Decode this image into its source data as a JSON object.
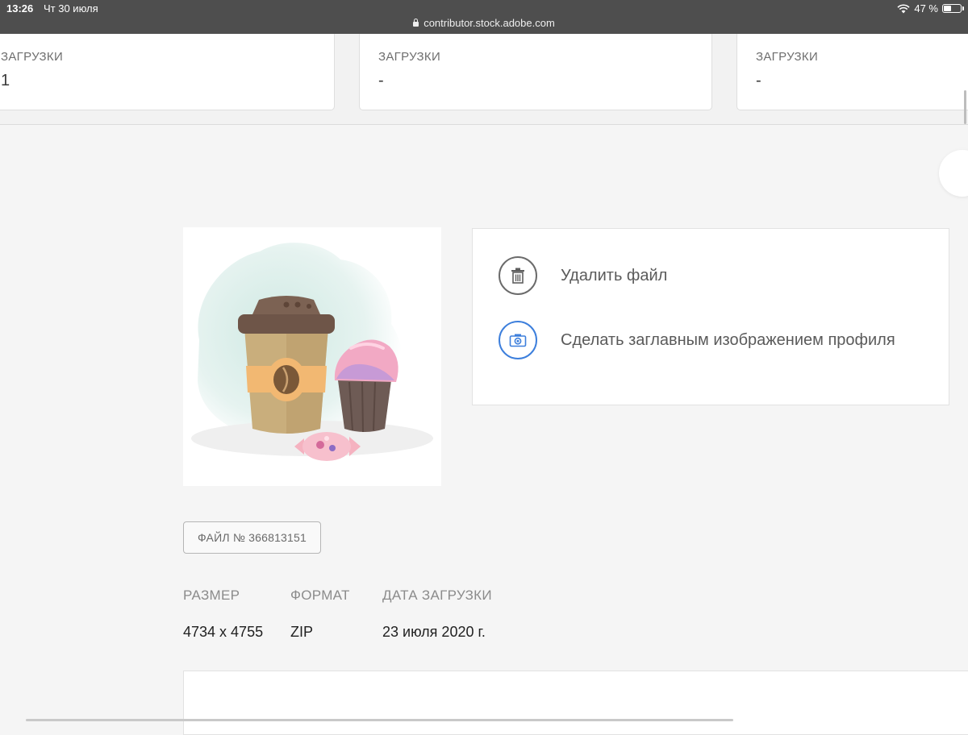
{
  "status_bar": {
    "time": "13:26",
    "date": "Чт 30 июля",
    "battery": "47 %",
    "battery_level": 0.47,
    "url": "contributor.stock.adobe.com"
  },
  "stats": [
    {
      "label": "ЗАГРУЗКИ",
      "value": "1"
    },
    {
      "label": "ЗАГРУЗКИ",
      "value": "-"
    },
    {
      "label": "ЗАГРУЗКИ",
      "value": "-"
    }
  ],
  "actions": {
    "delete_label": "Удалить файл",
    "set_profile_label": "Сделать заглавным изображением профиля",
    "delete_icon": "trash-icon",
    "profile_icon": "camera-icon",
    "delete_color": "#6b6b6b",
    "profile_color": "#3d7fdc"
  },
  "file": {
    "id_label": "ФАЙЛ № 366813151",
    "meta": [
      {
        "label": "РАЗМЕР",
        "value": "4734 x 4755"
      },
      {
        "label": "ФОРМАТ",
        "value": "ZIP"
      },
      {
        "label": "ДАТА ЗАГРУЗКИ",
        "value": "23 июля 2020 г."
      }
    ]
  }
}
